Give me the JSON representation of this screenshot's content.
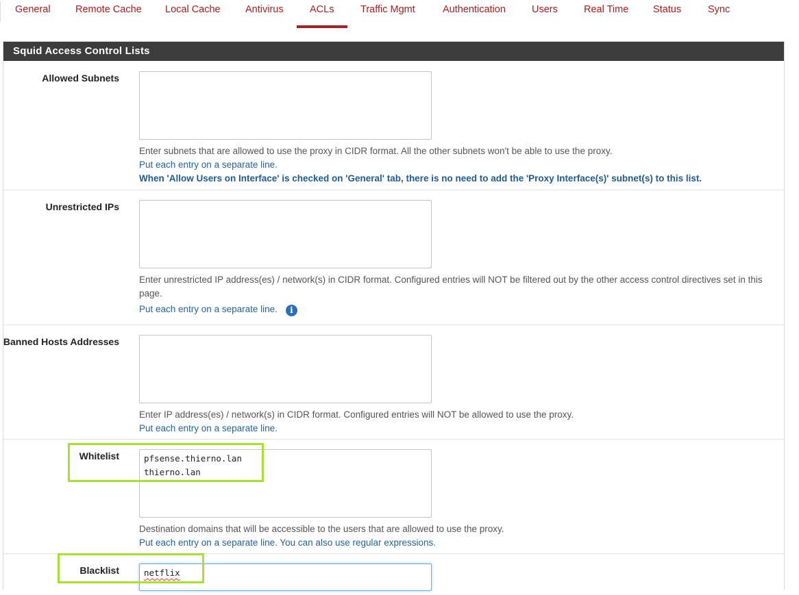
{
  "tabs": [
    {
      "label": "General"
    },
    {
      "label": "Remote Cache"
    },
    {
      "label": "Local Cache"
    },
    {
      "label": "Antivirus"
    },
    {
      "label": "ACLs"
    },
    {
      "label": "Traffic Mgmt"
    },
    {
      "label": "Authentication"
    },
    {
      "label": "Users"
    },
    {
      "label": "Real Time"
    },
    {
      "label": "Status"
    },
    {
      "label": "Sync"
    }
  ],
  "active_tab": "ACLs",
  "panel": {
    "title": "Squid Access Control Lists"
  },
  "fields": {
    "allowed_subnets": {
      "label": "Allowed Subnets",
      "value": "",
      "help1": "Enter subnets that are allowed to use the proxy in CIDR format. All the other subnets won't be able to use the proxy.",
      "help2": "Put each entry on a separate line.",
      "help3": "When 'Allow Users on Interface' is checked on 'General' tab, there is no need to add the 'Proxy Interface(s)' subnet(s) to this list."
    },
    "unrestricted_ips": {
      "label": "Unrestricted IPs",
      "value": "",
      "help1": "Enter unrestricted IP address(es) / network(s) in CIDR format. Configured entries will NOT be filtered out by the other access control directives set in this page.",
      "help2": "Put each entry on a separate line.",
      "info_icon": "i"
    },
    "banned_hosts": {
      "label": "Banned Hosts Addresses",
      "value": "",
      "help1": "Enter IP address(es) / network(s) in CIDR format. Configured entries will NOT be allowed to use the proxy.",
      "help2": "Put each entry on a separate line."
    },
    "whitelist": {
      "label": "Whitelist",
      "value": "pfsense.thierno.lan\nthierno.lan",
      "help1": "Destination domains that will be accessible to the users that are allowed to use the proxy.",
      "help2": "Put each entry on a separate line. You can also use regular expressions."
    },
    "blacklist": {
      "label": "Blacklist",
      "value": "netflix"
    }
  },
  "colors": {
    "accent": "#a72121",
    "tab_text": "#b01c1c",
    "highlight": "#a9e22a",
    "heading_bg": "#3c3c3c",
    "link": "#2463a0"
  }
}
